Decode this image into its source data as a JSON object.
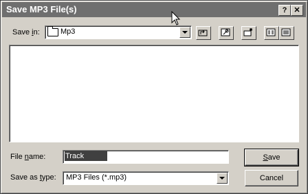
{
  "window": {
    "title": "Save MP3 File(s)"
  },
  "titlebar": {
    "help_label": "?",
    "close_label": "✕"
  },
  "save_in": {
    "label_pre": "Save ",
    "label_key": "i",
    "label_post": "n:",
    "value": "Mp3"
  },
  "toolbar": {
    "icons": [
      "up-one-level-icon",
      "desktop-icon",
      "new-folder-icon",
      "list-view-icon",
      "details-view-icon"
    ]
  },
  "file_name": {
    "label_pre": "File ",
    "label_key": "n",
    "label_post": "ame:",
    "value": "Track"
  },
  "save_as_type": {
    "label_pre": "Save as ",
    "label_key": "t",
    "label_post": "ype:",
    "value": "MP3 Files (*.mp3)"
  },
  "buttons": {
    "save_key": "S",
    "save_rest": "ave",
    "cancel_label": "Cancel"
  },
  "colors": {
    "titlebar": "#6f6f6f",
    "face": "#d4d0c8",
    "selection": "#404040"
  }
}
